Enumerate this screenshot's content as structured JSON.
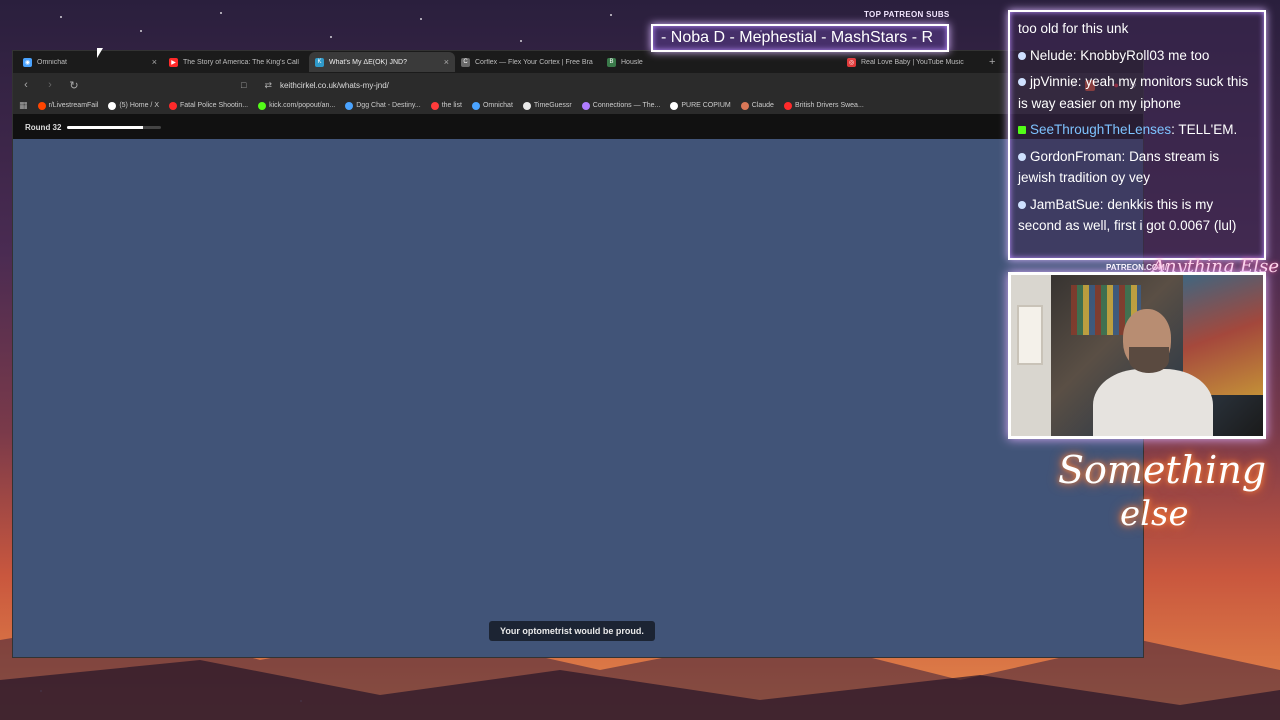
{
  "browser": {
    "tabs": [
      {
        "title": "Omnichat",
        "active": false,
        "closable": true
      },
      {
        "title": "The Story of America: The King's Call",
        "active": false,
        "closable": false
      },
      {
        "title": "What's My ΔE(OK) JND?",
        "active": true,
        "closable": true
      },
      {
        "title": "Corflex — Flex Your Cortex | Free Bra",
        "active": false,
        "closable": false
      },
      {
        "title": "Housle",
        "active": false,
        "closable": false
      },
      {
        "title": "Real Love Baby | YouTube Music",
        "active": false,
        "closable": false
      }
    ],
    "url": "keithcirkel.co.uk/whats-my-jnd/",
    "bookmarks": [
      {
        "label": "r/LivestreamFail",
        "color": "#ff4500"
      },
      {
        "label": "(5) Home / X",
        "color": "#ffffff"
      },
      {
        "label": "Fatal Police Shootin...",
        "color": "#ff2a2a"
      },
      {
        "label": "kick.com/popout/an...",
        "color": "#53fc18"
      },
      {
        "label": "Dgg Chat - Destiny...",
        "color": "#4aa3ff"
      },
      {
        "label": "the list",
        "color": "#ff3b3b"
      },
      {
        "label": "Omnichat",
        "color": "#4aa3ff"
      },
      {
        "label": "TimeGuessr",
        "color": "#e8e8e8"
      },
      {
        "label": "Connections — The...",
        "color": "#b07cff"
      },
      {
        "label": "PURE COPIUM",
        "color": "#ffffff"
      },
      {
        "label": "Claude",
        "color": "#d97757"
      },
      {
        "label": "British Drivers Swea...",
        "color": "#ff2a2a"
      }
    ]
  },
  "site": {
    "round_label": "Round 32",
    "progress": 0.8,
    "background_color": "#415478",
    "toast": "Your optometrist would be proud."
  },
  "overlay": {
    "subs_label": "TOP PATREON SUBS",
    "subs_text": "-  Noba D - Mephestial - MashStars - R",
    "chat": [
      {
        "user": "",
        "text": "too old for this unk",
        "badge": "none",
        "highlight": false
      },
      {
        "user": "Nelude",
        "text": "KnobbyRoll03 me too",
        "badge": "circle",
        "highlight": false
      },
      {
        "user": "jpVinnie",
        "text": "yeah my monitors suck this is way easier on my iphone",
        "badge": "circle",
        "highlight": false
      },
      {
        "user": "SeeThroughTheLenses",
        "text": "TELL'EM.",
        "badge": "kick",
        "highlight": true
      },
      {
        "user": "GordonFroman",
        "text": "Dans stream is jewish tradition oy vey",
        "badge": "circle",
        "highlight": false
      },
      {
        "user": "JamBatSue",
        "text": "denkkis this is my second as well, first i got 0.0067 (lul)",
        "badge": "circle",
        "highlight": false
      }
    ],
    "cam_label": "PATREON.COM/",
    "cam_logo": "Anything Else",
    "neon_line1": "Something",
    "neon_line2": "else"
  }
}
